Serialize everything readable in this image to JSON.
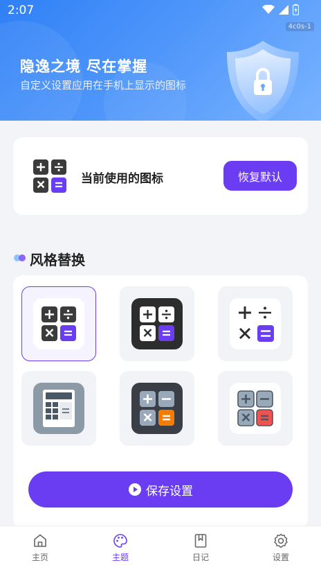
{
  "status": {
    "time": "2:07",
    "build_tag": "4c0s-1"
  },
  "hero": {
    "title": "隐逸之境 尽在掌握",
    "subtitle": "自定义设置应用在手机上显示的图标"
  },
  "current": {
    "label": "当前使用的图标",
    "restore_label": "恢复默认"
  },
  "section": {
    "title": "风格替换"
  },
  "styles": [
    {
      "name": "light-dark-keys",
      "selected": true
    },
    {
      "name": "dark-background",
      "selected": false
    },
    {
      "name": "minimal-symbols",
      "selected": false
    },
    {
      "name": "classic-calculator",
      "selected": false
    },
    {
      "name": "dark-orange-equals",
      "selected": false
    },
    {
      "name": "outlined-red-equals",
      "selected": false
    }
  ],
  "save_label": "保存设置",
  "nav": [
    {
      "label": "主页",
      "icon": "home-icon",
      "active": false
    },
    {
      "label": "主题",
      "icon": "palette-icon",
      "active": true
    },
    {
      "label": "日记",
      "icon": "bookmark-icon",
      "active": false
    },
    {
      "label": "设置",
      "icon": "gear-icon",
      "active": false
    }
  ],
  "colors": {
    "accent": "#6a3df2",
    "header_start": "#2f80f6",
    "header_end": "#79b3ff",
    "orange": "#f57c00",
    "red": "#ef5350"
  }
}
